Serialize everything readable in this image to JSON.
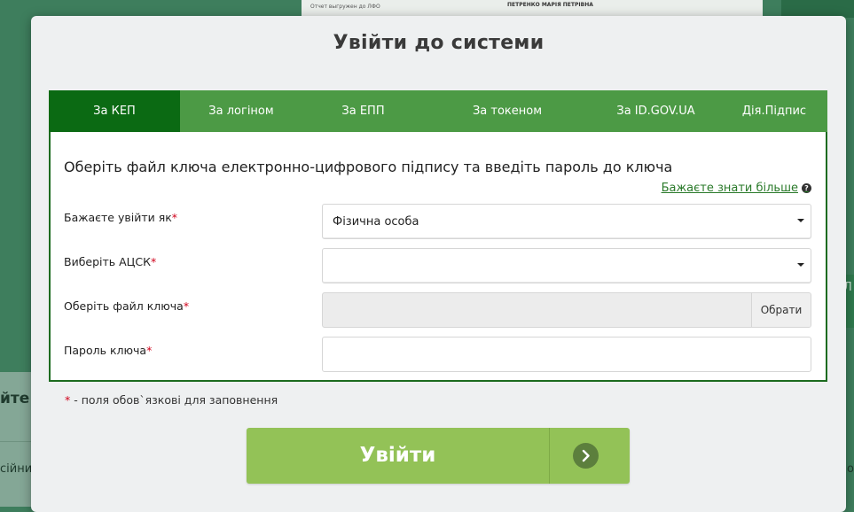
{
  "background": {
    "doc_text": "Отчет выгружен до ЛФО",
    "person_name": "ПЕТРЕНКО МАРІЯ ПЕТРІВНА",
    "left_text_1": "йте",
    "left_text_2": "сійни",
    "right_text": "о",
    "right_btn_text": "Л"
  },
  "modal": {
    "title": "Увійти до системи",
    "tabs": [
      {
        "label": "За КЕП",
        "active": true
      },
      {
        "label": "За логіном",
        "active": false
      },
      {
        "label": "За ЕПП",
        "active": false
      },
      {
        "label": "За токеном",
        "active": false
      },
      {
        "label": "За ID.GOV.UA",
        "active": false
      },
      {
        "label": "Дія.Підпис",
        "active": false
      }
    ],
    "heading": "Оберіть файл ключа електронно-цифрового підпису та введіть пароль до ключа",
    "learn_more": "Бажаєте знати більше",
    "form": {
      "login_as_label": "Бажаєте увійти як",
      "login_as_value": "Фізична особа",
      "acsk_label": "Виберіть АЦСК",
      "acsk_value": "",
      "key_file_label": "Оберіть файл ключа",
      "key_file_button": "Обрати",
      "password_label": "Пароль ключа",
      "password_value": "",
      "required_mark": "*"
    },
    "required_note_star": "*",
    "required_note": " - поля обов`язкові для заповнення",
    "submit_label": "Увійти"
  },
  "colors": {
    "tab_bar": "#4c9a45",
    "tab_active": "#0b6a13",
    "submit": "#93c257",
    "required": "#d0021b"
  }
}
